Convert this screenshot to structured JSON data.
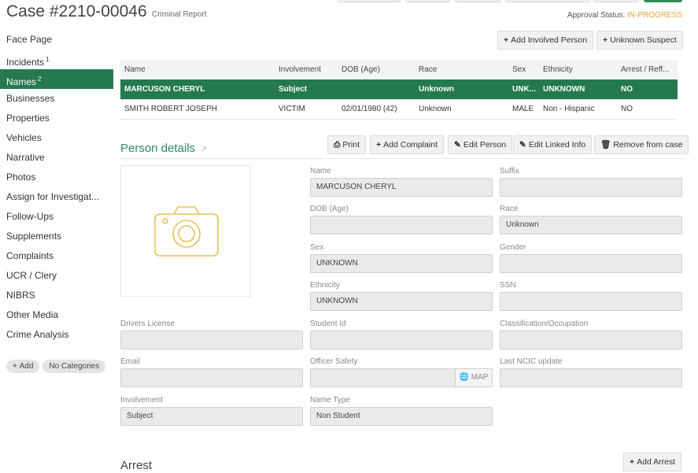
{
  "header": {
    "case_title": "Case #2210-00046",
    "case_subtitle": "Criminal Report",
    "approval_label": "Approval Status:",
    "approval_value": "IN-PROGRESS"
  },
  "sidebar": {
    "items": [
      {
        "label": "Face Page",
        "count": ""
      },
      {
        "label": "Incidents",
        "count": "1"
      },
      {
        "label": "Names",
        "count": "2"
      },
      {
        "label": "Businesses",
        "count": ""
      },
      {
        "label": "Properties",
        "count": ""
      },
      {
        "label": "Vehicles",
        "count": ""
      },
      {
        "label": "Narrative",
        "count": ""
      },
      {
        "label": "Photos",
        "count": ""
      },
      {
        "label": "Assign for Investigat...",
        "count": ""
      },
      {
        "label": "Follow-Ups",
        "count": ""
      },
      {
        "label": "Supplements",
        "count": ""
      },
      {
        "label": "Complaints",
        "count": ""
      },
      {
        "label": "UCR / Clery",
        "count": ""
      },
      {
        "label": "NIBRS",
        "count": ""
      },
      {
        "label": "Other Media",
        "count": ""
      },
      {
        "label": "Crime Analysis",
        "count": ""
      }
    ],
    "add_tag": "Add",
    "no_categories_tag": "No Categories"
  },
  "toolbar": {
    "add_involved_person": "Add Involved Person",
    "unknown_suspect": "Unknown Suspect"
  },
  "names_table": {
    "columns": [
      "Name",
      "Involvement",
      "DOB (Age)",
      "Race",
      "Sex",
      "Ethnicity",
      "Arrest / Reff..."
    ],
    "rows": [
      [
        "MARCUSON CHERYL",
        "Subject",
        "",
        "Unknown",
        "UNK...",
        "UNKNOWN",
        "NO"
      ],
      [
        "SMITH ROBERT JOSEPH",
        "VICTIM",
        "02/01/1980 (42)",
        "Unknown",
        "MALE",
        "Non - Hispanic",
        "NO"
      ]
    ]
  },
  "person_details": {
    "title": "Person details",
    "buttons": {
      "print": "Print",
      "add_complaint": "Add Complaint",
      "edit_person": "Edit Person",
      "edit_linked_info": "Edit Linked Info",
      "remove_from_case": "Remove from case"
    },
    "fields": {
      "name": {
        "label": "Name",
        "value": "MARCUSON CHERYL"
      },
      "suffix": {
        "label": "Suffix",
        "value": ""
      },
      "dob": {
        "label": "DOB (Age)",
        "value": ""
      },
      "race": {
        "label": "Race",
        "value": "Unknown"
      },
      "sex": {
        "label": "Sex",
        "value": "UNKNOWN"
      },
      "gender": {
        "label": "Gender",
        "value": ""
      },
      "ethnicity": {
        "label": "Ethnicity",
        "value": "UNKNOWN"
      },
      "ssn": {
        "label": "SSN",
        "value": ""
      },
      "drivers_license": {
        "label": "Drivers License",
        "value": ""
      },
      "student_id": {
        "label": "Student Id",
        "value": ""
      },
      "classification": {
        "label": "Classification/Occupation",
        "value": ""
      },
      "email": {
        "label": "Email",
        "value": ""
      },
      "officer_safety": {
        "label": "Officer Safety",
        "value": ""
      },
      "last_ncic": {
        "label": "Last NCIC update",
        "value": ""
      },
      "involvement": {
        "label": "Involvement",
        "value": "Subject"
      },
      "name_type": {
        "label": "Name Type",
        "value": "Non Student"
      }
    },
    "map_button": "MAP"
  },
  "arrest": {
    "title": "Arrest",
    "add_arrest": "Add Arrest"
  },
  "colors": {
    "accent_green": "#247a4d",
    "status_orange": "#e8a33a",
    "photo_icon": "#e6c256"
  },
  "icons": [
    "plus-icon",
    "print-icon",
    "pencil-icon",
    "trash-icon",
    "external-link-icon",
    "camera-icon",
    "globe-icon"
  ]
}
